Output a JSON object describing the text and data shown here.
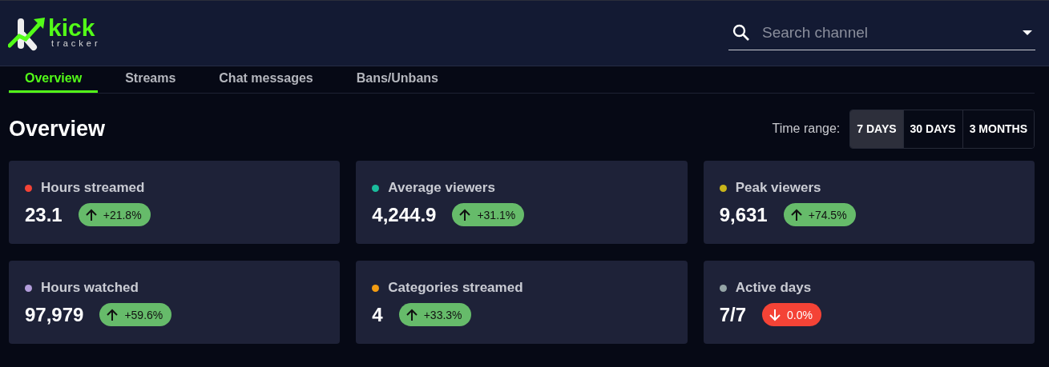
{
  "logo": {
    "word": "kick",
    "subword": "tracker"
  },
  "search": {
    "placeholder": "Search channel"
  },
  "tabs": [
    {
      "label": "Overview",
      "selected": true
    },
    {
      "label": "Streams",
      "selected": false
    },
    {
      "label": "Chat messages",
      "selected": false
    },
    {
      "label": "Bans/Unbans",
      "selected": false
    }
  ],
  "page_title": "Overview",
  "time_range": {
    "label": "Time range:",
    "options": [
      {
        "label": "7 DAYS",
        "selected": true
      },
      {
        "label": "30 DAYS",
        "selected": false
      },
      {
        "label": "3 MONTHS",
        "selected": false
      }
    ]
  },
  "stats": [
    {
      "label": "Hours streamed",
      "color": "#f44336",
      "value": "23.1",
      "change": "+21.8%",
      "increase": true
    },
    {
      "label": "Average viewers",
      "color": "#1abc9c",
      "value": "4,244.9",
      "change": "+31.1%",
      "increase": true
    },
    {
      "label": "Peak viewers",
      "color": "#c9b51a",
      "value": "9,631",
      "change": "+74.5%",
      "increase": true
    },
    {
      "label": "Hours watched",
      "color": "#b39ddb",
      "value": "97,979",
      "change": "+59.6%",
      "increase": true
    },
    {
      "label": "Categories streamed",
      "color": "#f39c12",
      "value": "4",
      "change": "+33.3%",
      "increase": true
    },
    {
      "label": "Active days",
      "color": "#95a5a6",
      "value": "7/7",
      "change": "0.0%",
      "increase": false
    }
  ]
}
